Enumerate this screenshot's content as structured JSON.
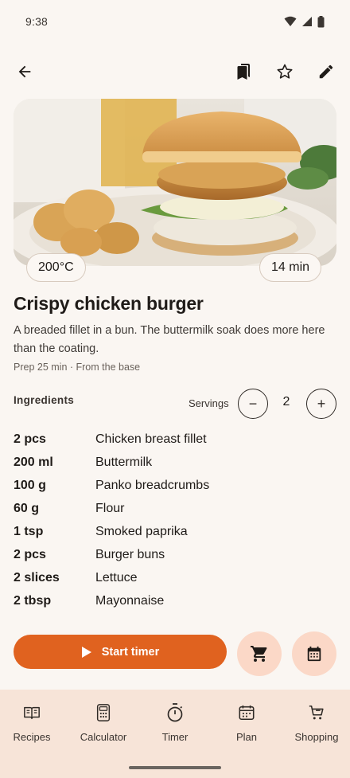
{
  "status_bar": {
    "time": "9:38"
  },
  "recipe": {
    "title": "Crispy chicken burger",
    "description": "A breaded fillet in a bun. The buttermilk soak does more here than the coating.",
    "meta": "Prep 25 min · From the base",
    "temperature": "200°C",
    "duration": "14 min"
  },
  "ingredients": {
    "heading": "Ingredients",
    "servings_label": "Servings",
    "servings_value": "2",
    "decrease_label": "−",
    "increase_label": "+",
    "items": [
      {
        "qty": "2 pcs",
        "name": "Chicken breast fillet"
      },
      {
        "qty": "200 ml",
        "name": "Buttermilk"
      },
      {
        "qty": "100 g",
        "name": "Panko breadcrumbs"
      },
      {
        "qty": "60 g",
        "name": "Flour"
      },
      {
        "qty": "1 tsp",
        "name": "Smoked paprika"
      },
      {
        "qty": "2 pcs",
        "name": "Burger buns"
      },
      {
        "qty": "2 slices",
        "name": "Lettuce"
      },
      {
        "qty": "2 tbsp",
        "name": "Mayonnaise"
      }
    ]
  },
  "actions": {
    "start_timer_label": "Start timer",
    "cart_icon": "cart-icon",
    "calendar_icon": "calendar-icon"
  },
  "bottom_nav": {
    "items": [
      {
        "label": "Recipes",
        "icon": "book-icon"
      },
      {
        "label": "Calculator",
        "icon": "calculator-icon"
      },
      {
        "label": "Timer",
        "icon": "stopwatch-icon"
      },
      {
        "label": "Plan",
        "icon": "calendar-icon"
      },
      {
        "label": "Shopping",
        "icon": "cart-icon"
      }
    ]
  },
  "colors": {
    "accent": "#e0621f",
    "fab_bg": "#fbd8c7",
    "nav_bg": "#f7e4d8",
    "page_bg": "#faf6f2"
  }
}
